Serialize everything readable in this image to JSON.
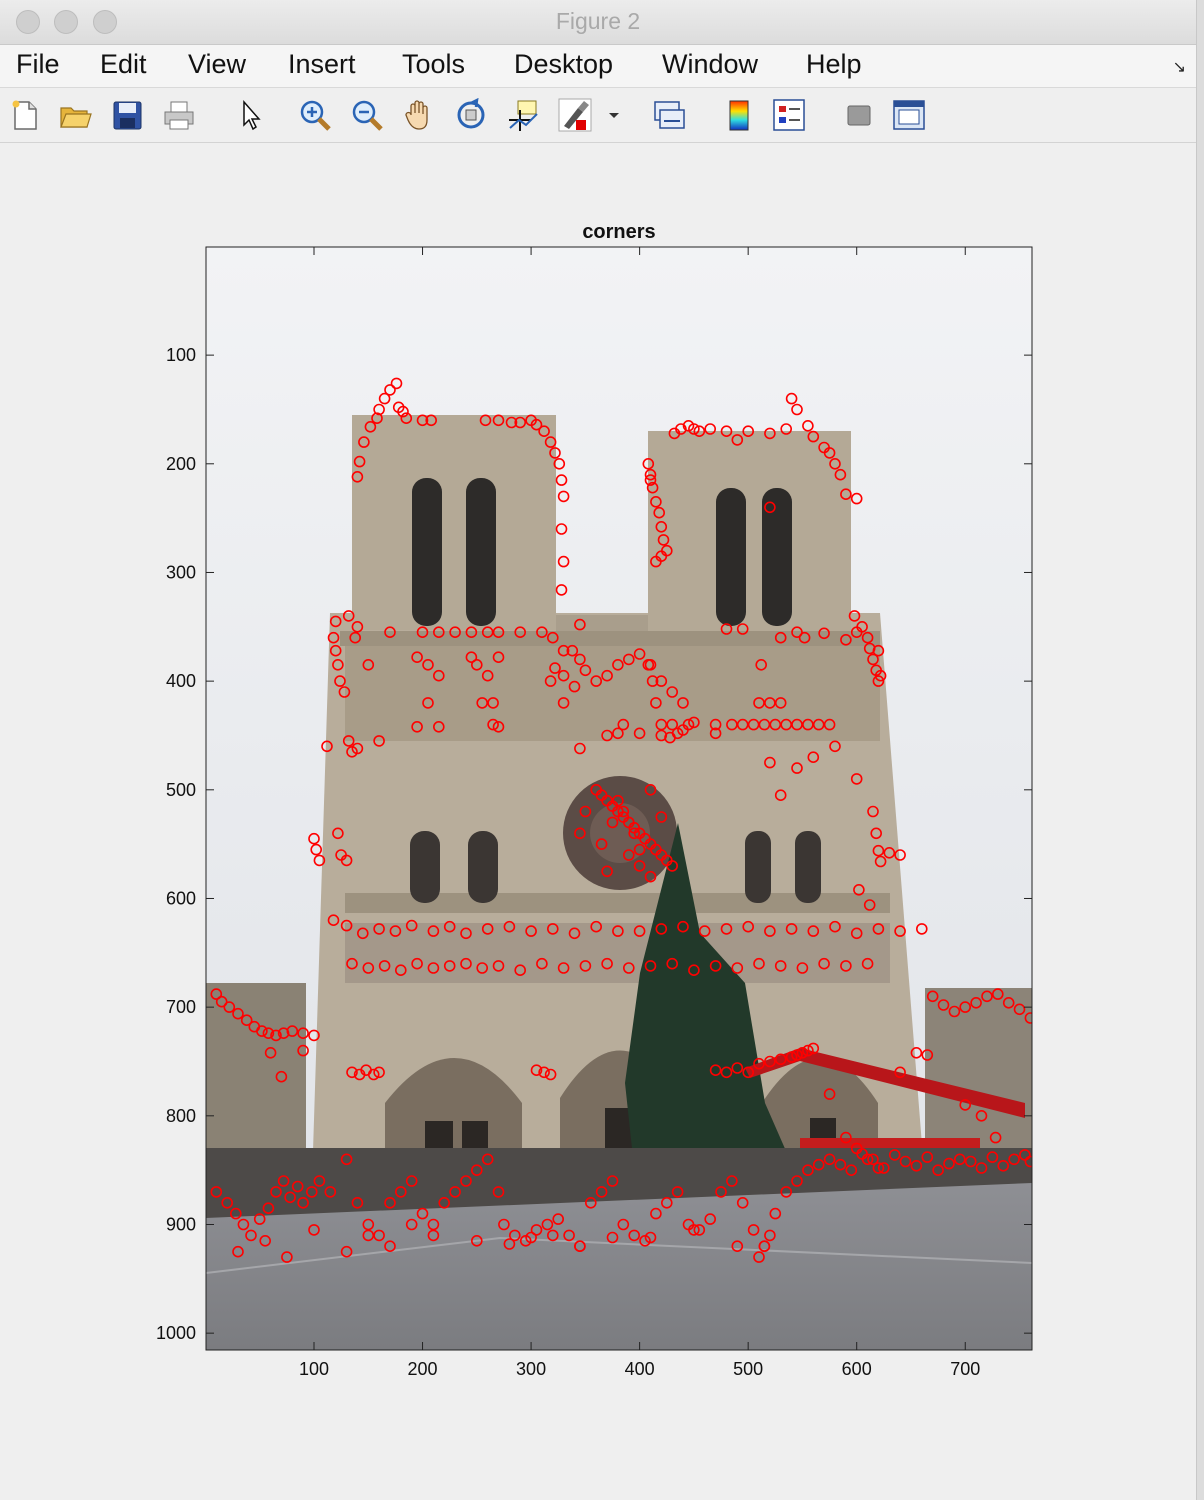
{
  "window": {
    "title": "Figure 2"
  },
  "menu": [
    "File",
    "Edit",
    "View",
    "Insert",
    "Tools",
    "Desktop",
    "Window",
    "Help"
  ],
  "toolbar": {
    "icons": [
      "new-figure-icon",
      "open-file-icon",
      "save-icon",
      "print-icon",
      "edit-plot-arrow-icon",
      "zoom-in-icon",
      "zoom-out-icon",
      "pan-hand-icon",
      "rotate-3d-icon",
      "data-cursor-icon",
      "brush-icon",
      "brush-dropdown-icon",
      "link-plot-icon",
      "insert-colorbar-icon",
      "insert-legend-icon",
      "hide-plot-tools-icon",
      "show-plot-tools-icon"
    ]
  },
  "colors": {
    "marker": "#ff0000",
    "sky": "#e9ebee",
    "stone": "#b7ab98",
    "plaza": "#8d8e92"
  },
  "chart_data": {
    "type": "scatter",
    "title": "corners",
    "xlabel": "",
    "ylabel": "",
    "xlim": [
      0.5,
      761.5
    ],
    "ylim": [
      1015.5,
      0.5
    ],
    "y_reversed": true,
    "xticks": [
      "100",
      "200",
      "300",
      "400",
      "500",
      "600",
      "700"
    ],
    "yticks": [
      "100",
      "200",
      "300",
      "400",
      "500",
      "600",
      "700",
      "800",
      "900",
      "1000"
    ],
    "grid": false,
    "marker": "o",
    "marker_color": "#ff0000",
    "series": [
      {
        "x": [
          176,
          170,
          165,
          160,
          158,
          152,
          146,
          142,
          140,
          178,
          182,
          185,
          200,
          208,
          258,
          270,
          282,
          290,
          300,
          305,
          312,
          318,
          322,
          326,
          328,
          330,
          328,
          330,
          328
        ],
        "y": [
          126,
          132,
          140,
          150,
          158,
          166,
          180,
          198,
          212,
          148,
          152,
          158,
          160,
          160,
          160,
          160,
          162,
          162,
          160,
          164,
          170,
          180,
          190,
          200,
          215,
          230,
          260,
          290,
          316
        ]
      },
      {
        "x": [
          120,
          118,
          120,
          122,
          124,
          128,
          132,
          140,
          138,
          150,
          170,
          200,
          215,
          230,
          245,
          260,
          270,
          290,
          310,
          320,
          330,
          345
        ],
        "y": [
          345,
          360,
          372,
          385,
          400,
          410,
          340,
          350,
          360,
          385,
          355,
          355,
          355,
          355,
          355,
          355,
          355,
          355,
          355,
          360,
          372,
          348
        ]
      },
      {
        "x": [
          195,
          205,
          205,
          215,
          215,
          195,
          245,
          250,
          255,
          260,
          265,
          270,
          265,
          270
        ],
        "y": [
          378,
          385,
          420,
          395,
          442,
          442,
          378,
          385,
          420,
          395,
          440,
          378,
          420,
          442
        ]
      },
      {
        "x": [
          322,
          318,
          330,
          340,
          330,
          338,
          345,
          350,
          360,
          370,
          380,
          390,
          400,
          410,
          420,
          430,
          440,
          445,
          440,
          435,
          428,
          420,
          415,
          412,
          408
        ],
        "y": [
          388,
          400,
          395,
          405,
          420,
          372,
          380,
          390,
          400,
          395,
          385,
          380,
          375,
          385,
          400,
          410,
          420,
          440,
          445,
          448,
          452,
          440,
          420,
          400,
          385
        ]
      },
      {
        "x": [
          408,
          410,
          412,
          415,
          418,
          420,
          422,
          425,
          420,
          415,
          410,
          432,
          438,
          445,
          450,
          455
        ],
        "y": [
          200,
          210,
          222,
          235,
          245,
          258,
          270,
          280,
          285,
          290,
          215,
          172,
          168,
          165,
          168,
          170
        ]
      },
      {
        "x": [
          465,
          480,
          500,
          520,
          535,
          545,
          555,
          560,
          570,
          575,
          580,
          585,
          590,
          600,
          540,
          520,
          490
        ],
        "y": [
          168,
          170,
          170,
          172,
          168,
          150,
          165,
          175,
          185,
          190,
          200,
          210,
          228,
          232,
          140,
          240,
          178
        ]
      },
      {
        "x": [
          598,
          605,
          610,
          612,
          615,
          618,
          620,
          622,
          620,
          600,
          590,
          570,
          552,
          545,
          530,
          512,
          495,
          480
        ],
        "y": [
          340,
          350,
          360,
          370,
          380,
          390,
          400,
          395,
          372,
          355,
          362,
          356,
          360,
          355,
          360,
          385,
          352,
          352
        ]
      },
      {
        "x": [
          485,
          495,
          505,
          515,
          525,
          535,
          545,
          555,
          565,
          575,
          530,
          520,
          510
        ],
        "y": [
          440,
          440,
          440,
          440,
          440,
          440,
          440,
          440,
          440,
          440,
          420,
          420,
          420
        ]
      },
      {
        "x": [
          100,
          102,
          105,
          112,
          118,
          122,
          125,
          130,
          132,
          135,
          140,
          160,
          345,
          370,
          380,
          385,
          400,
          420,
          430,
          450,
          470,
          470,
          520,
          530,
          545,
          560,
          580,
          600,
          615,
          618,
          620,
          622,
          630,
          640,
          602,
          612
        ],
        "y": [
          545,
          555,
          565,
          460,
          620,
          540,
          560,
          565,
          455,
          465,
          462,
          455,
          462,
          450,
          448,
          440,
          448,
          450,
          440,
          438,
          440,
          448,
          475,
          505,
          480,
          470,
          460,
          490,
          520,
          540,
          556,
          566,
          558,
          560,
          592,
          606
        ]
      },
      {
        "x": [
          360,
          365,
          370,
          375,
          380,
          385,
          390,
          395,
          400,
          405,
          410,
          415,
          420,
          425,
          430,
          380,
          385,
          375,
          395,
          365,
          390,
          400,
          370,
          410,
          420,
          350,
          345,
          400,
          410
        ],
        "y": [
          500,
          505,
          510,
          515,
          520,
          525,
          530,
          535,
          540,
          545,
          550,
          555,
          560,
          565,
          570,
          510,
          520,
          530,
          540,
          550,
          560,
          570,
          575,
          580,
          525,
          520,
          540,
          555,
          500
        ]
      },
      {
        "x": [
          130,
          145,
          160,
          175,
          190,
          210,
          225,
          240,
          260,
          280,
          300,
          320,
          340,
          360,
          380,
          400,
          420,
          440,
          460,
          480,
          500,
          520,
          540,
          560,
          580,
          600,
          620,
          640,
          660
        ],
        "y": [
          625,
          632,
          628,
          630,
          625,
          630,
          626,
          632,
          628,
          626,
          630,
          628,
          632,
          626,
          630,
          630,
          628,
          626,
          630,
          628,
          626,
          630,
          628,
          630,
          626,
          632,
          628,
          630,
          628
        ]
      },
      {
        "x": [
          135,
          150,
          165,
          180,
          195,
          210,
          225,
          240,
          255,
          270,
          290,
          310,
          330,
          350,
          370,
          390,
          410,
          430,
          450,
          470,
          490,
          510,
          530,
          550,
          570,
          590,
          610
        ],
        "y": [
          660,
          664,
          662,
          666,
          660,
          664,
          662,
          660,
          664,
          662,
          666,
          660,
          664,
          662,
          660,
          664,
          662,
          660,
          666,
          662,
          664,
          660,
          662,
          664,
          660,
          662,
          660
        ]
      },
      {
        "x": [
          10,
          15,
          22,
          30,
          38,
          45,
          52,
          58,
          65,
          72,
          80,
          90,
          100,
          60,
          70,
          90
        ],
        "y": [
          688,
          695,
          700,
          706,
          712,
          718,
          722,
          724,
          726,
          724,
          722,
          724,
          726,
          742,
          764,
          740
        ]
      },
      {
        "x": [
          135,
          142,
          148,
          155,
          160,
          305,
          312,
          318
        ],
        "y": [
          760,
          762,
          758,
          762,
          760,
          758,
          760,
          762
        ]
      },
      {
        "x": [
          470,
          480,
          490,
          500,
          510,
          520,
          530,
          540,
          545,
          550,
          555,
          560,
          575,
          590,
          600,
          610,
          620,
          640,
          655,
          665
        ],
        "y": [
          758,
          760,
          756,
          760,
          752,
          750,
          748,
          746,
          744,
          742,
          740,
          738,
          780,
          820,
          830,
          840,
          848,
          760,
          742,
          744
        ]
      },
      {
        "x": [
          670,
          680,
          690,
          700,
          710,
          720,
          730,
          740,
          750,
          760,
          700,
          715,
          728
        ],
        "y": [
          690,
          698,
          704,
          700,
          696,
          690,
          688,
          696,
          702,
          710,
          790,
          800,
          820
        ]
      },
      {
        "x": [
          10,
          20,
          28,
          35,
          42,
          50,
          58,
          65,
          72,
          78,
          85,
          90,
          98,
          105,
          115,
          130,
          140,
          150,
          160,
          170,
          180,
          190,
          200,
          210,
          220,
          230,
          240,
          250,
          260,
          270
        ],
        "y": [
          870,
          880,
          890,
          900,
          910,
          895,
          885,
          870,
          860,
          875,
          865,
          880,
          870,
          860,
          870,
          840,
          880,
          900,
          910,
          880,
          870,
          860,
          890,
          900,
          880,
          870,
          860,
          850,
          840,
          870
        ]
      },
      {
        "x": [
          275,
          285,
          295,
          305,
          315,
          325,
          335,
          345,
          355,
          365,
          375,
          385,
          395,
          405,
          415,
          425,
          435,
          445,
          455,
          465,
          475,
          485,
          495,
          505,
          515,
          525,
          535,
          545,
          555,
          565
        ],
        "y": [
          900,
          910,
          915,
          905,
          900,
          895,
          910,
          920,
          880,
          870,
          860,
          900,
          910,
          915,
          890,
          880,
          870,
          900,
          905,
          895,
          870,
          860,
          880,
          905,
          920,
          890,
          870,
          860,
          850,
          845
        ]
      },
      {
        "x": [
          575,
          585,
          595,
          605,
          615,
          625,
          635,
          645,
          655,
          665,
          675,
          685,
          695,
          705,
          715,
          725,
          735,
          745,
          755,
          760
        ],
        "y": [
          840,
          845,
          850,
          835,
          840,
          848,
          836,
          842,
          846,
          838,
          850,
          844,
          840,
          842,
          848,
          838,
          846,
          840,
          836,
          842
        ]
      },
      {
        "x": [
          30,
          55,
          75,
          100,
          130,
          150,
          170,
          190,
          210,
          250,
          280,
          300,
          320,
          345,
          375,
          410,
          450,
          490,
          510,
          515,
          520
        ],
        "y": [
          925,
          915,
          930,
          905,
          925,
          910,
          920,
          900,
          910,
          915,
          918,
          912,
          910,
          920,
          912,
          912,
          905,
          920,
          930,
          920,
          910
        ]
      }
    ]
  }
}
